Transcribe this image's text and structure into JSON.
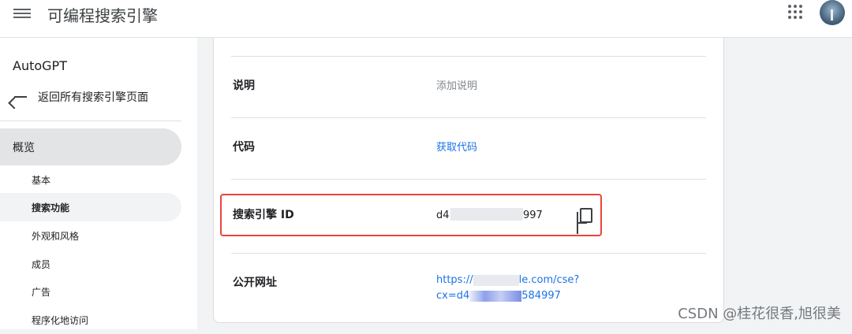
{
  "app": {
    "title": "可编程搜索引擎"
  },
  "sidebar": {
    "project_name": "AutoGPT",
    "back_label": "返回所有搜索引擎页面",
    "overview_label": "概览",
    "items": [
      {
        "label": "基本"
      },
      {
        "label": "搜索功能"
      },
      {
        "label": "外观和风格"
      },
      {
        "label": "成员"
      },
      {
        "label": "广告"
      },
      {
        "label": "程序化地访问"
      }
    ]
  },
  "main": {
    "description": {
      "label": "说明",
      "value": "添加说明"
    },
    "code": {
      "label": "代码",
      "link": "获取代码"
    },
    "engine_id": {
      "label": "搜索引擎 ID",
      "value_prefix": "d4",
      "value_suffix": "997"
    },
    "public_url": {
      "label": "公开网址",
      "line1_start": "https://",
      "line1_end": "le.com/cse?",
      "line2_start": "cx=d4",
      "line2_end": "584997"
    }
  },
  "watermark": "CSDN @桂花很香,旭很美"
}
